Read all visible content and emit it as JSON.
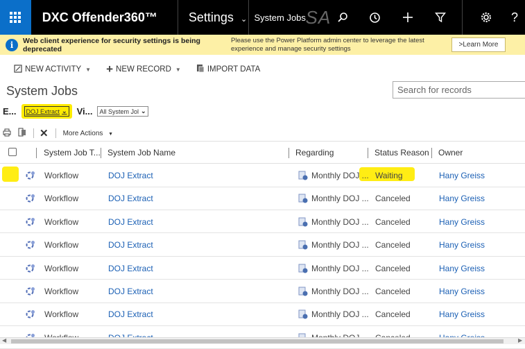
{
  "header": {
    "app_title": "DXC Offender360™",
    "area": "Settings",
    "entity": "System Jobs",
    "ghost_text": "SA",
    "icons": [
      "search-icon",
      "history-icon",
      "plus-icon",
      "filter-icon",
      "gear-icon",
      "help-icon"
    ],
    "help_glyph": "?"
  },
  "notice": {
    "title": "Web client experience for security settings is being deprecated",
    "message": "Please use the Power Platform admin center to leverage the latest experience and manage security settings",
    "button": ">Learn More"
  },
  "commands": [
    {
      "label": "NEW ACTIVITY",
      "icon": "new-activity-icon",
      "dropdown": true
    },
    {
      "label": "NEW RECORD",
      "icon": "plus-icon",
      "dropdown": true
    },
    {
      "label": "IMPORT DATA",
      "icon": "import-icon",
      "dropdown": false
    }
  ],
  "page": {
    "title": "System Jobs",
    "search_placeholder": "Search for records"
  },
  "view": {
    "label1": "E...",
    "select1": "DOJ Extract",
    "label2": "Vi...",
    "select2": "All System Jol"
  },
  "gridtools": {
    "more_actions": "More Actions"
  },
  "grid": {
    "columns": [
      "System Job T...",
      "System Job Name",
      "Regarding",
      "Status Reason",
      "Owner"
    ],
    "rows": [
      {
        "type": "Workflow",
        "name": "DOJ Extract",
        "regarding": "Monthly DOJ ...",
        "status": "Waiting",
        "owner": "Hany Greiss"
      },
      {
        "type": "Workflow",
        "name": "DOJ Extract",
        "regarding": "Monthly DOJ ...",
        "status": "Canceled",
        "owner": "Hany Greiss"
      },
      {
        "type": "Workflow",
        "name": "DOJ Extract",
        "regarding": "Monthly DOJ ...",
        "status": "Canceled",
        "owner": "Hany Greiss"
      },
      {
        "type": "Workflow",
        "name": "DOJ Extract",
        "regarding": "Monthly DOJ ...",
        "status": "Canceled",
        "owner": "Hany Greiss"
      },
      {
        "type": "Workflow",
        "name": "DOJ Extract",
        "regarding": "Monthly DOJ ...",
        "status": "Canceled",
        "owner": "Hany Greiss"
      },
      {
        "type": "Workflow",
        "name": "DOJ Extract",
        "regarding": "Monthly DOJ ...",
        "status": "Canceled",
        "owner": "Hany Greiss"
      },
      {
        "type": "Workflow",
        "name": "DOJ Extract",
        "regarding": "Monthly DOJ ...",
        "status": "Canceled",
        "owner": "Hany Greiss"
      },
      {
        "type": "Workflow",
        "name": "DOJ Extract",
        "regarding": "Monthly DOJ ...",
        "status": "Canceled",
        "owner": "Hany Greiss"
      }
    ]
  },
  "colors": {
    "topbar": "#000000",
    "waffle": "#0b6fc9",
    "notice_bg": "#fdf0a6",
    "highlight": "#ffeb00",
    "link": "#1a5fb4"
  }
}
